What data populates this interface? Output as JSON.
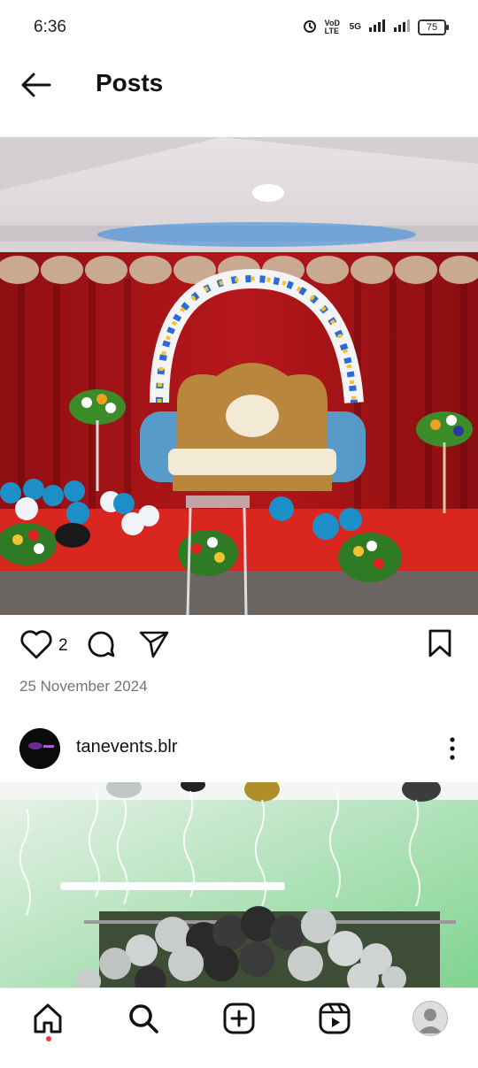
{
  "status_bar": {
    "time": "6:36",
    "network_label": "VoD LTE",
    "network_type": "5G",
    "battery_level": "75"
  },
  "header": {
    "title": "Posts"
  },
  "post": {
    "like_count": "2",
    "date": "25 November 2024"
  },
  "next_post": {
    "username": "tanevents.blr"
  },
  "bottom_nav": {
    "items": [
      "home-icon",
      "search-icon",
      "create-icon",
      "reels-icon",
      "profile-icon"
    ],
    "active": "home-icon"
  },
  "colors": {
    "accent_notification": "#ff3040",
    "text_primary": "#111111",
    "text_secondary": "#737373"
  }
}
